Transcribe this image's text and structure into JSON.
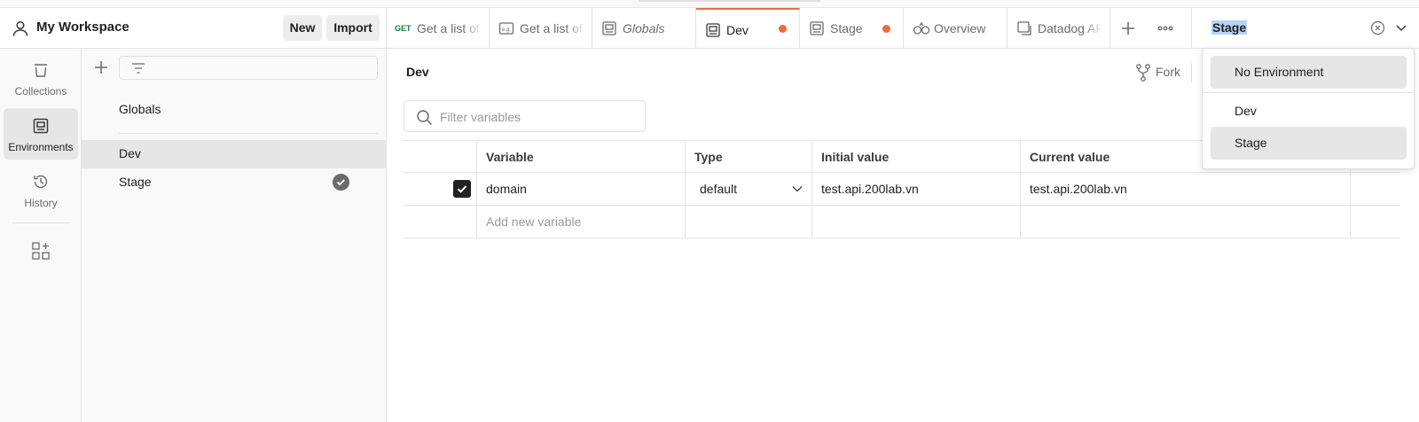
{
  "workspace": {
    "name": "My Workspace",
    "new_label": "New",
    "import_label": "Import"
  },
  "tabs": [
    {
      "method": "GET",
      "label": "Get a list of",
      "icon": "request-icon"
    },
    {
      "label": "Get a list of",
      "icon": "example-icon"
    },
    {
      "label": "Globals",
      "icon": "environment-icon"
    },
    {
      "label": "Dev",
      "icon": "environment-icon",
      "active": true,
      "unsaved": true
    },
    {
      "label": "Stage",
      "icon": "environment-icon",
      "unsaved": true
    },
    {
      "label": "Overview",
      "icon": "overview-icon"
    },
    {
      "label": "Datadog AP",
      "icon": "api-icon"
    }
  ],
  "environment_selector": {
    "value": "Stage"
  },
  "rail": [
    {
      "label": "Collections",
      "icon": "collections-icon"
    },
    {
      "label": "Environments",
      "icon": "environments-icon",
      "selected": true
    },
    {
      "label": "History",
      "icon": "history-icon"
    }
  ],
  "sidebar": {
    "items": [
      {
        "label": "Globals"
      },
      {
        "label": "Dev",
        "selected": true
      },
      {
        "label": "Stage",
        "active_badge": true
      }
    ]
  },
  "main": {
    "title": "Dev",
    "fork_label": "Fork",
    "search_placeholder": "Filter variables",
    "columns": [
      "Variable",
      "Type",
      "Initial value",
      "Current value"
    ],
    "rows": [
      {
        "enabled": true,
        "variable": "domain",
        "type": "default",
        "initial": "test.api.200lab.vn",
        "current": "test.api.200lab.vn"
      }
    ],
    "new_row_placeholder": "Add new variable"
  },
  "dropdown": {
    "items": [
      {
        "label": "No Environment"
      },
      {
        "label": "Dev"
      },
      {
        "label": "Stage",
        "highlighted": true
      }
    ]
  },
  "colors": {
    "accent": "#ef6c3a",
    "selection": "#b6d3f6",
    "get_method": "#0f7d3b"
  }
}
